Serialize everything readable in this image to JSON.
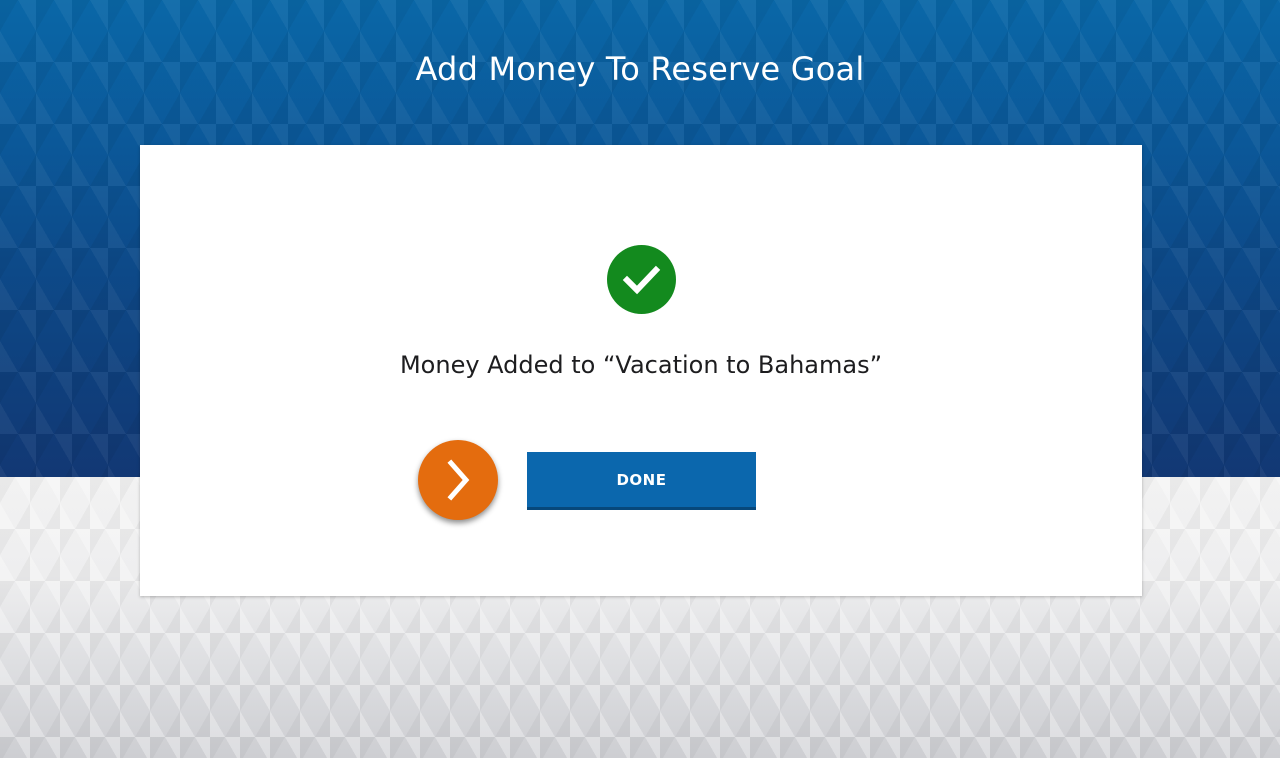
{
  "header": {
    "title": "Add Money To Reserve Goal"
  },
  "confirmation": {
    "status_icon": "check-circle-icon",
    "message_prefix": "Money Added to ",
    "goal_name": "“Vacation to Bahamas”",
    "hint_icon": "chevron-right-icon",
    "done_label": "DONE"
  },
  "colors": {
    "header_blue": "#0b5899",
    "success_green": "#138a1e",
    "accent_orange": "#e46c0e",
    "button_blue": "#0b67ad"
  }
}
